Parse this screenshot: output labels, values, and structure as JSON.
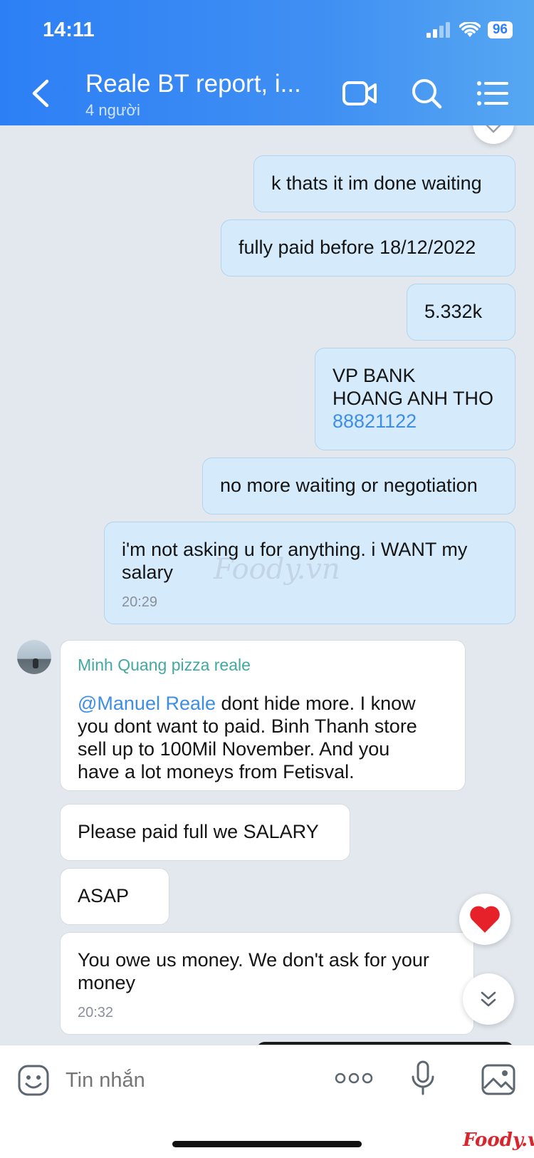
{
  "status_bar": {
    "time": "14:11",
    "battery": "96"
  },
  "header": {
    "title": "Reale BT report, i...",
    "subtitle": "4 người"
  },
  "messages": {
    "m1": "k thats it im done waiting",
    "m2": "fully paid before 18/12/2022",
    "m3": "5.332k",
    "m4": {
      "line1": "VP BANK",
      "line2": "HOANG ANH THO",
      "line3": "88821122"
    },
    "m5": "no more waiting or negotiation",
    "m6": {
      "line1": "i'm not asking u for anything. i WANT my",
      "line2": "salary",
      "time": "20:29"
    },
    "m7": {
      "sender": "Minh Quang pizza reale",
      "mention": "@Manuel Reale",
      "line1": " dont hide more. I know",
      "line2": "you dont want to paid. Binh Thanh store",
      "line3": "sell up to 100Mil November. And you",
      "line4": "have a lot moneys from Fetisval."
    },
    "m8": "Please paid full we SALARY",
    "m9": "ASAP",
    "m10": {
      "line1": "You owe us money. We don't ask for your",
      "line2": "money",
      "time": "20:32"
    }
  },
  "composer": {
    "placeholder": "Tin nhắn"
  },
  "watermarks": {
    "center": "Foody.vn",
    "corner": "Foody.vn"
  },
  "icons": {
    "back": "chevron-left-icon",
    "video": "video-call-icon",
    "search": "search-icon",
    "menu": "list-menu-icon",
    "react": "heart-icon",
    "scroll": "double-chevron-down-icon",
    "sticker": "sticker-icon",
    "more": "more-options-icon",
    "mic": "microphone-icon",
    "gallery": "image-gallery-icon"
  },
  "colors": {
    "header_start": "#2d7ff5",
    "header_end": "#56a7f2",
    "outgoing_bubble": "#d5ebfc",
    "link": "#3e8de6",
    "sender": "#43a8a0",
    "heart": "#e62129"
  }
}
